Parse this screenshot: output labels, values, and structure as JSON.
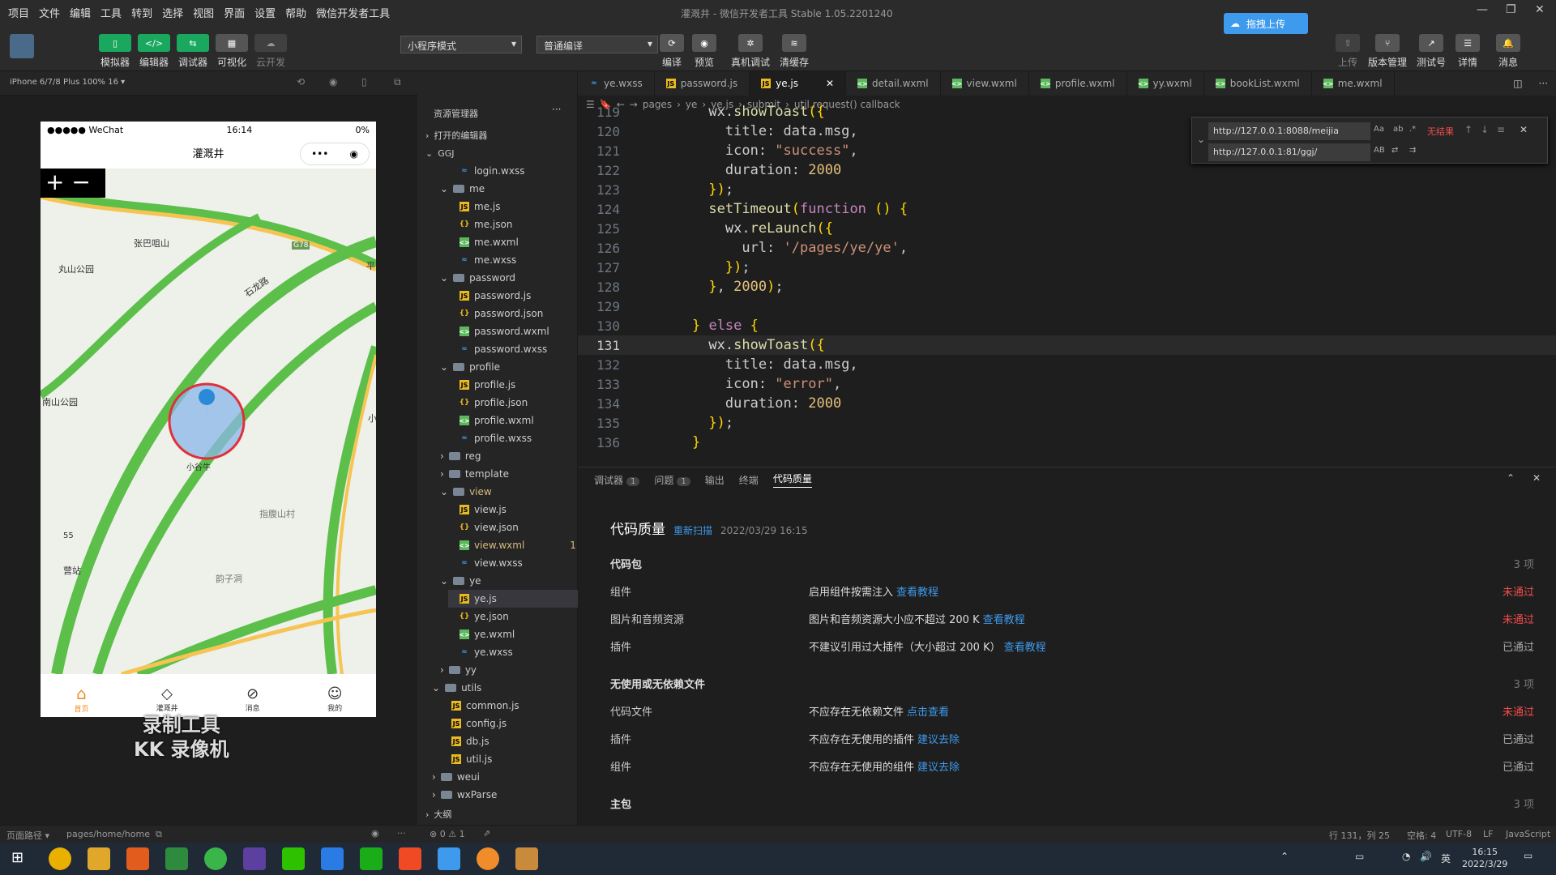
{
  "menu": [
    "项目",
    "文件",
    "编辑",
    "工具",
    "转到",
    "选择",
    "视图",
    "界面",
    "设置",
    "帮助",
    "微信开发者工具"
  ],
  "window_title": "灌溉井 - 微信开发者工具 Stable 1.05.2201240",
  "upload_label": "拖拽上传",
  "toolbar": {
    "simulator": "模拟器",
    "editor": "编辑器",
    "debugger": "调试器",
    "visual": "可视化",
    "cloud": "云开发",
    "mode": "小程序模式",
    "compile_mode": "普通编译",
    "compile": "编译",
    "preview": "预览",
    "real_debug": "真机调试",
    "clear_cache": "清缓存",
    "upload": "上传",
    "version": "版本管理",
    "test": "测试号",
    "detail": "详情",
    "message": "消息"
  },
  "device": "iPhone 6/7/8 Plus 100% 16 ▾",
  "phone": {
    "carrier": "●●●●● WeChat",
    "time": "16:14",
    "battery": "0%",
    "title": "灌溉井",
    "map_labels": [
      "张巴咀山",
      "丸山公园",
      "石龙路",
      "G78",
      "南山公园",
      "小谷牛",
      "指腹山村",
      "韵子洞",
      "营站",
      "55",
      "平",
      "小"
    ],
    "tabs": [
      "首页",
      "灌溉井",
      "消息",
      "我的"
    ]
  },
  "watermark": [
    "录制工具",
    "KK 录像机"
  ],
  "explorer": {
    "title": "资源管理器",
    "open_editors": "打开的编辑器",
    "root": "GGJ",
    "items": [
      {
        "name": "login.wxss",
        "type": "wxss",
        "indent": 2
      },
      {
        "name": "me",
        "type": "folder",
        "indent": 1,
        "open": true
      },
      {
        "name": "me.js",
        "type": "js",
        "indent": 2
      },
      {
        "name": "me.json",
        "type": "json",
        "indent": 2
      },
      {
        "name": "me.wxml",
        "type": "wxml",
        "indent": 2
      },
      {
        "name": "me.wxss",
        "type": "wxss",
        "indent": 2
      },
      {
        "name": "password",
        "type": "folder",
        "indent": 1,
        "open": true
      },
      {
        "name": "password.js",
        "type": "js",
        "indent": 2
      },
      {
        "name": "password.json",
        "type": "json",
        "indent": 2
      },
      {
        "name": "password.wxml",
        "type": "wxml",
        "indent": 2
      },
      {
        "name": "password.wxss",
        "type": "wxss",
        "indent": 2
      },
      {
        "name": "profile",
        "type": "folder",
        "indent": 1,
        "open": true
      },
      {
        "name": "profile.js",
        "type": "js",
        "indent": 2
      },
      {
        "name": "profile.json",
        "type": "json",
        "indent": 2
      },
      {
        "name": "profile.wxml",
        "type": "wxml",
        "indent": 2
      },
      {
        "name": "profile.wxss",
        "type": "wxss",
        "indent": 2
      },
      {
        "name": "reg",
        "type": "folder",
        "indent": 1
      },
      {
        "name": "template",
        "type": "folder",
        "indent": 1
      },
      {
        "name": "view",
        "type": "folder",
        "indent": 1,
        "open": true
      },
      {
        "name": "view.js",
        "type": "js",
        "indent": 2
      },
      {
        "name": "view.json",
        "type": "json",
        "indent": 2
      },
      {
        "name": "view.wxml",
        "type": "wxml",
        "indent": 2
      },
      {
        "name": "view.wxss",
        "type": "wxss",
        "indent": 2
      },
      {
        "name": "ye",
        "type": "folder",
        "indent": 1,
        "open": true
      },
      {
        "name": "ye.js",
        "type": "js",
        "indent": 2
      },
      {
        "name": "ye.json",
        "type": "json",
        "indent": 2
      },
      {
        "name": "ye.wxml",
        "type": "wxml",
        "indent": 2
      },
      {
        "name": "ye.wxss",
        "type": "wxss",
        "indent": 2
      },
      {
        "name": "yy",
        "type": "folder",
        "indent": 1
      },
      {
        "name": "utils",
        "type": "folder",
        "indent": 0,
        "open": true
      },
      {
        "name": "common.js",
        "type": "js",
        "indent": 1
      },
      {
        "name": "config.js",
        "type": "js",
        "indent": 1
      },
      {
        "name": "db.js",
        "type": "js",
        "indent": 1
      },
      {
        "name": "util.js",
        "type": "js",
        "indent": 1
      },
      {
        "name": "weui",
        "type": "folder",
        "indent": 0
      },
      {
        "name": "wxParse",
        "type": "folder",
        "indent": 0
      }
    ],
    "view_badge": "1",
    "outline": "大纲"
  },
  "file_tabs": [
    "ye.wxss",
    "password.js",
    "ye.js",
    "detail.wxml",
    "view.wxml",
    "profile.wxml",
    "yy.wxml",
    "bookList.wxml",
    "me.wxml"
  ],
  "breadcrumb": [
    "pages",
    "ye",
    "ye.js",
    "submit",
    "util.request() callback"
  ],
  "find": {
    "query": "http://127.0.0.1:8088/meijia",
    "replace": "http://127.0.0.1:81/ggj/",
    "result": "无结果"
  },
  "code_lines": [
    {
      "n": "119",
      "t": "      wx.showToast({"
    },
    {
      "n": "120",
      "t": "        title: data.msg,"
    },
    {
      "n": "121",
      "t": "        icon: \"success\","
    },
    {
      "n": "122",
      "t": "        duration: 2000"
    },
    {
      "n": "123",
      "t": "      });"
    },
    {
      "n": "124",
      "t": "      setTimeout(function () {"
    },
    {
      "n": "125",
      "t": "        wx.reLaunch({"
    },
    {
      "n": "126",
      "t": "          url: '/pages/ye/ye',"
    },
    {
      "n": "127",
      "t": "        });"
    },
    {
      "n": "128",
      "t": "      }, 2000);"
    },
    {
      "n": "129",
      "t": ""
    },
    {
      "n": "130",
      "t": "    } else {"
    },
    {
      "n": "131",
      "t": "      wx.showToast({"
    },
    {
      "n": "132",
      "t": "        title: data.msg,"
    },
    {
      "n": "133",
      "t": "        icon: \"error\","
    },
    {
      "n": "134",
      "t": "        duration: 2000"
    },
    {
      "n": "135",
      "t": "      });"
    },
    {
      "n": "136",
      "t": "    }"
    }
  ],
  "panel": {
    "tabs": [
      "调试器",
      "问题",
      "输出",
      "终端",
      "代码质量"
    ],
    "debugger_badge": "1",
    "problems_badge": "1",
    "title": "代码质量",
    "rescan": "重新扫描",
    "date": "2022/03/29 16:15",
    "sections": [
      {
        "name": "代码包",
        "count": "3 项",
        "rows": [
          {
            "a": "组件",
            "b": "启用组件按需注入",
            "link": "查看教程",
            "s": "未通过",
            "fail": true
          },
          {
            "a": "图片和音频资源",
            "b": "图片和音频资源大小应不超过 200 K",
            "link": "查看教程",
            "s": "未通过",
            "fail": true
          },
          {
            "a": "插件",
            "b": "不建议引用过大插件（大小超过 200 K）",
            "link": "查看教程",
            "s": "已通过",
            "fail": false
          }
        ]
      },
      {
        "name": "无使用或无依赖文件",
        "count": "3 项",
        "rows": [
          {
            "a": "代码文件",
            "b": "不应存在无依赖文件",
            "link": "点击查看",
            "s": "未通过",
            "fail": true
          },
          {
            "a": "插件",
            "b": "不应存在无使用的插件",
            "link": "建议去除",
            "s": "已通过",
            "fail": false
          },
          {
            "a": "组件",
            "b": "不应存在无使用的组件",
            "link": "建议去除",
            "s": "已通过",
            "fail": false
          }
        ]
      },
      {
        "name": "主包",
        "count": "3 项",
        "rows": []
      }
    ]
  },
  "status": {
    "path_label": "页面路径 ▾",
    "path": "pages/home/home",
    "errors": "⊗ 0 ⚠ 1",
    "pos": "行 131，列 25",
    "spaces": "空格: 4",
    "enc": "UTF-8",
    "eol": "LF",
    "lang": "JavaScript"
  },
  "taskbar": {
    "time": "16:15",
    "date": "2022/3/29",
    "ime": "英"
  }
}
